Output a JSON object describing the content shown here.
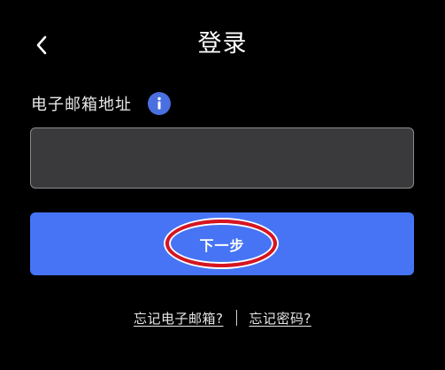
{
  "header": {
    "back_icon": "chevron-left-icon",
    "title": "登录"
  },
  "form": {
    "email_label": "电子邮箱地址",
    "info_icon": "info-icon",
    "email_value": "",
    "email_placeholder": "",
    "next_label": "下一步"
  },
  "links": {
    "forgot_email": "忘记电子邮箱?",
    "forgot_password": "忘记密码?"
  },
  "colors": {
    "background": "#000000",
    "input_background": "#3a3a3c",
    "primary_button": "#4674f5",
    "info_icon": "#4a6fe0",
    "highlight_annotation": "#d8141f"
  }
}
